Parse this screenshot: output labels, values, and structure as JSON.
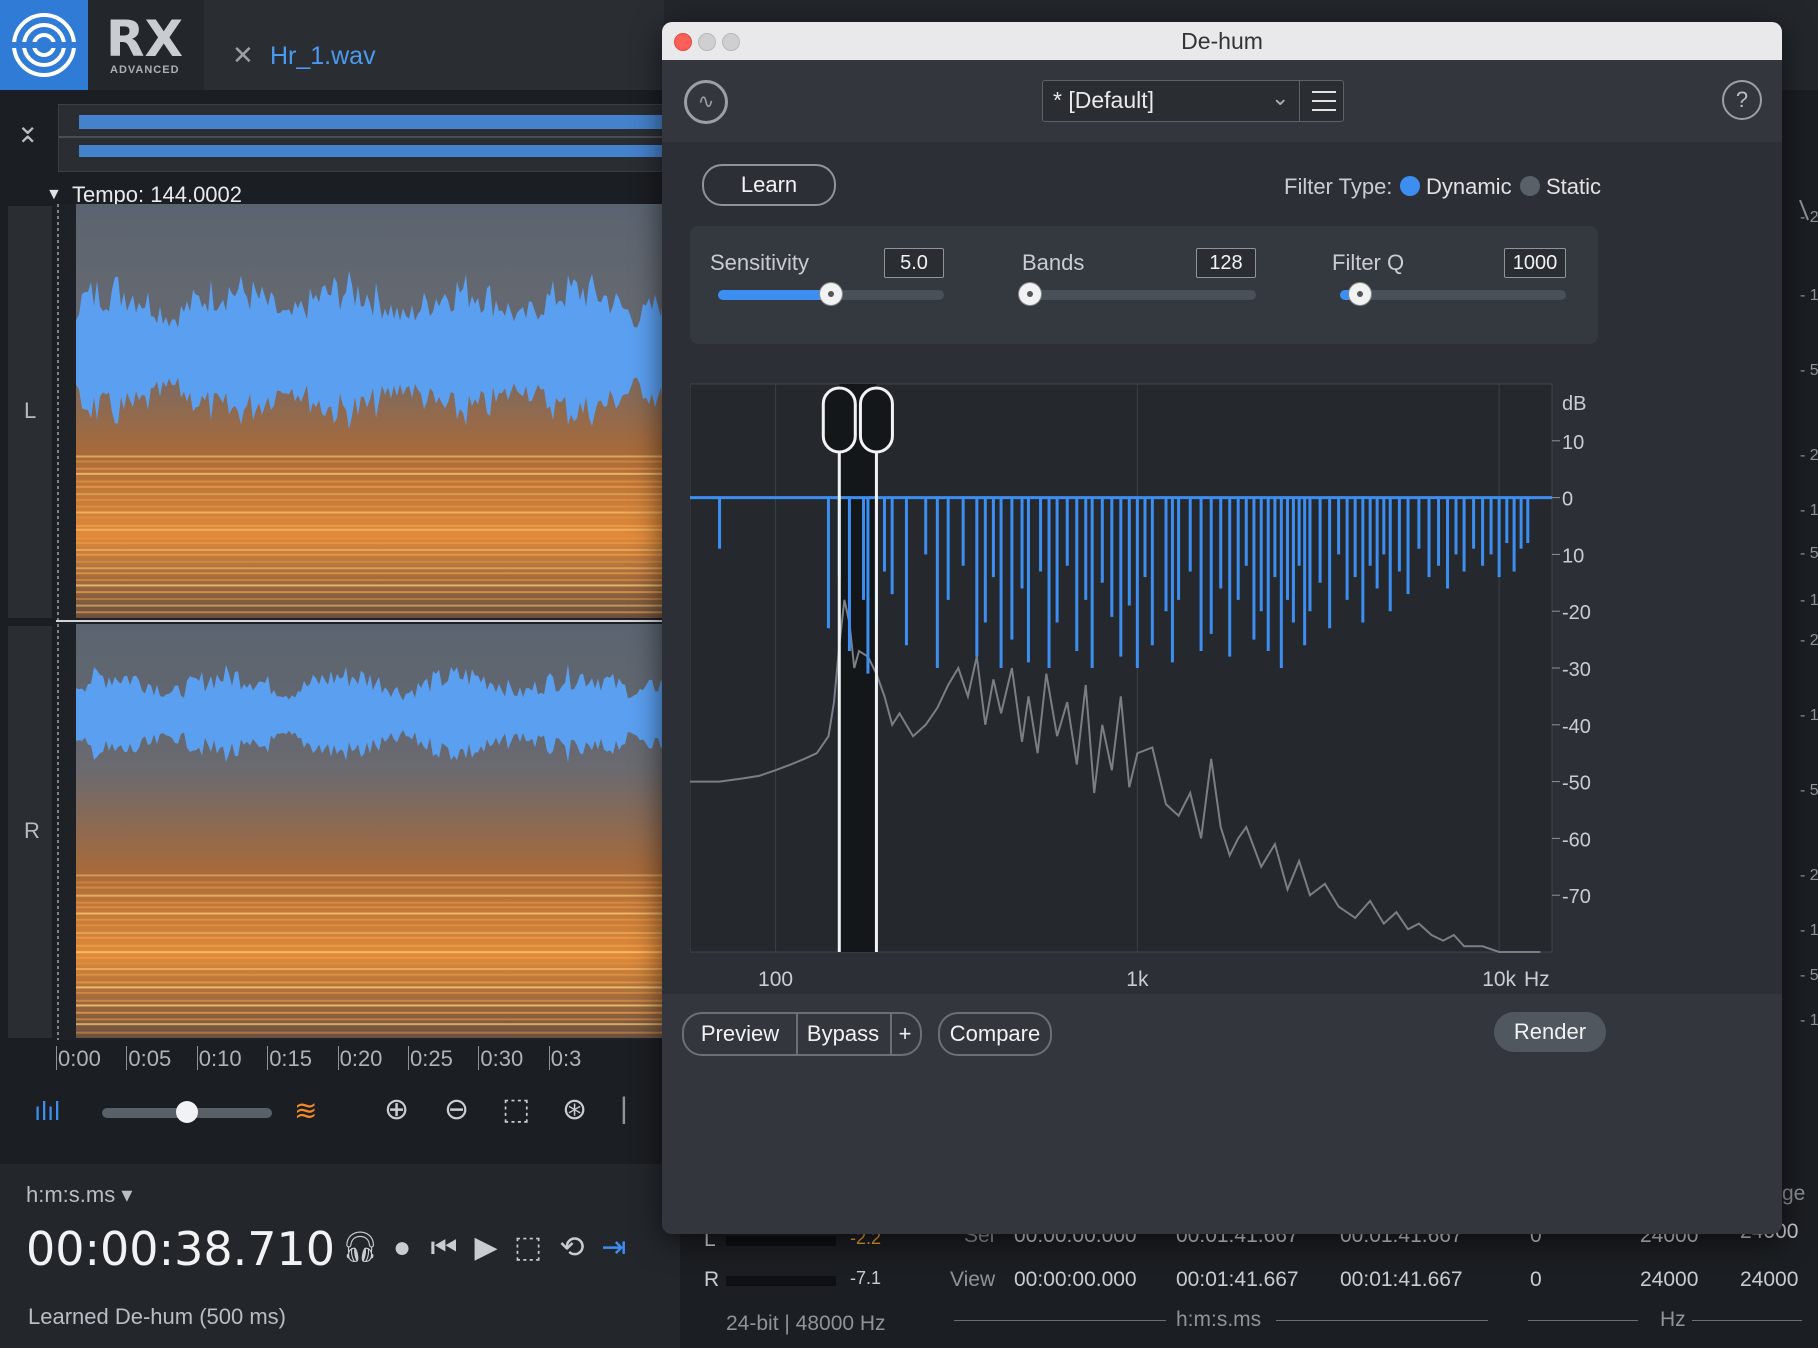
{
  "app": {
    "logo_text": "RX",
    "logo_subtitle": "ADVANCED",
    "file_tab": "Hr_1.wav",
    "tempo": "Tempo: 144.0002",
    "channels": [
      "L",
      "R"
    ],
    "timeline_ticks": [
      "0:00",
      "0:05",
      "0:10",
      "0:15",
      "0:20",
      "0:25",
      "0:30",
      "0:3"
    ],
    "time_format": "h:m:s.ms",
    "time_readout": "00:00:38.710",
    "status": "Learned De-hum (500 ms)",
    "accent": "#2f7bd6"
  },
  "meters": {
    "rows": [
      {
        "label": "L",
        "value": "-2.2"
      },
      {
        "label": "R",
        "value": "-7.1"
      }
    ],
    "format": "24-bit | 48000 Hz"
  },
  "selection": {
    "rows": [
      {
        "label": "Sel",
        "start": "00:00:00.000",
        "end": "00:01:41.667",
        "length": "00:01:41.667"
      },
      {
        "label": "View",
        "start": "00:00:00.000",
        "end": "00:01:41.667",
        "length": "00:01:41.667"
      }
    ],
    "unit": "h:m:s.ms"
  },
  "freq_range": {
    "rows": [
      {
        "low": "0",
        "high": "24000",
        "range": "24000"
      },
      {
        "low": "0",
        "high": "24000",
        "range": "24000"
      }
    ],
    "unit": "Hz",
    "header_partial": "ge"
  },
  "plugin": {
    "window_title": "De-hum",
    "preset": "* [Default]",
    "help": "?",
    "learn_label": "Learn",
    "filter_type_label": "Filter Type:",
    "filter_types": [
      "Dynamic",
      "Static"
    ],
    "filter_type_selected": "Dynamic",
    "sliders": [
      {
        "label": "Sensitivity",
        "value": "5.0",
        "fraction": 0.5
      },
      {
        "label": "Bands",
        "value": "128",
        "fraction": 0.0
      },
      {
        "label": "Filter Q",
        "value": "1000",
        "fraction": 0.09
      }
    ],
    "buttons": {
      "preview": "Preview",
      "bypass": "Bypass",
      "plus": "+",
      "compare": "Compare",
      "render": "Render"
    }
  },
  "chart_data": {
    "type": "line",
    "title": "",
    "xlabel": "Hz",
    "ylabel": "dB",
    "x_scale": "log",
    "xlim": [
      58,
      14000
    ],
    "ylim": [
      -80,
      20
    ],
    "x_ticks": [
      {
        "value": 100,
        "label": "100"
      },
      {
        "value": 1000,
        "label": "1k"
      },
      {
        "value": 10000,
        "label": "10k"
      }
    ],
    "y_ticks": [
      {
        "value": 10,
        "label": "10"
      },
      {
        "value": 0,
        "label": "0"
      },
      {
        "value": -10,
        "label": "10"
      },
      {
        "value": -20,
        "label": "-20"
      },
      {
        "value": -30,
        "label": "-30"
      },
      {
        "value": -40,
        "label": "-40"
      },
      {
        "value": -50,
        "label": "-50"
      },
      {
        "value": -60,
        "label": "-60"
      },
      {
        "value": -70,
        "label": "-70"
      }
    ],
    "grid": true,
    "filter_line_db": 0,
    "handles_hz": [
      150,
      190
    ],
    "filter_bands": {
      "hz": [
        70,
        140,
        150,
        160,
        175,
        180,
        190,
        200,
        210,
        230,
        260,
        280,
        300,
        330,
        360,
        380,
        400,
        420,
        450,
        480,
        500,
        540,
        570,
        600,
        640,
        680,
        720,
        750,
        800,
        850,
        900,
        950,
        1000,
        1050,
        1100,
        1200,
        1250,
        1300,
        1400,
        1500,
        1600,
        1700,
        1800,
        1900,
        2000,
        2100,
        2200,
        2300,
        2400,
        2500,
        2600,
        2700,
        2800,
        2900,
        3000,
        3200,
        3400,
        3600,
        3800,
        4000,
        4200,
        4400,
        4600,
        4800,
        5000,
        5300,
        5600,
        6000,
        6400,
        6800,
        7200,
        7600,
        8000,
        8500,
        9000,
        9500,
        10000,
        10500,
        11000,
        11500,
        12000
      ],
      "depth_db": [
        -9,
        -23,
        -14,
        -27,
        -18,
        -31,
        -22,
        -13,
        -17,
        -26,
        -10,
        -30,
        -18,
        -12,
        -28,
        -22,
        -14,
        -30,
        -25,
        -16,
        -29,
        -13,
        -30,
        -22,
        -12,
        -27,
        -18,
        -30,
        -15,
        -21,
        -28,
        -19,
        -30,
        -14,
        -26,
        -20,
        -29,
        -18,
        -13,
        -27,
        -24,
        -16,
        -28,
        -18,
        -12,
        -25,
        -20,
        -27,
        -14,
        -30,
        -18,
        -22,
        -12,
        -26,
        -20,
        -15,
        -23,
        -10,
        -18,
        -14,
        -22,
        -12,
        -16,
        -10,
        -20,
        -13,
        -17,
        -9,
        -14,
        -12,
        -16,
        -10,
        -13,
        -9,
        -12,
        -10,
        -14,
        -8,
        -13,
        -9,
        -8
      ]
    },
    "spectrum": {
      "hz": [
        58,
        70,
        80,
        90,
        100,
        110,
        120,
        130,
        140,
        145,
        150,
        155,
        160,
        165,
        170,
        180,
        190,
        200,
        210,
        220,
        240,
        260,
        280,
        300,
        320,
        340,
        360,
        380,
        400,
        420,
        450,
        480,
        500,
        530,
        560,
        600,
        640,
        680,
        720,
        760,
        800,
        850,
        900,
        950,
        1000,
        1100,
        1200,
        1300,
        1400,
        1500,
        1600,
        1700,
        1800,
        1900,
        2000,
        2200,
        2400,
        2600,
        2800,
        3000,
        3300,
        3600,
        4000,
        4400,
        4800,
        5200,
        5600,
        6000,
        6500,
        7000,
        7500,
        8000,
        9000,
        10000,
        11000,
        12000,
        13000
      ],
      "db": [
        -50,
        -50,
        -49.5,
        -49,
        -48,
        -47,
        -46,
        -45,
        -42,
        -36,
        -26,
        -18,
        -22,
        -30,
        -27,
        -28,
        -31,
        -35,
        -40,
        -38,
        -42,
        -40,
        -37,
        -33,
        -30,
        -35,
        -28,
        -40,
        -32,
        -38,
        -30,
        -43,
        -35,
        -45,
        -31,
        -42,
        -36,
        -47,
        -33,
        -52,
        -40,
        -48,
        -35,
        -51,
        -45,
        -44,
        -54,
        -56,
        -52,
        -60,
        -46,
        -58,
        -63,
        -60,
        -58,
        -65,
        -61,
        -69,
        -64,
        -70,
        -68,
        -72,
        -74,
        -71,
        -75,
        -73,
        -76,
        -75,
        -77,
        -78,
        -77,
        -79,
        -79,
        -80,
        -80,
        -80,
        -80
      ]
    }
  }
}
